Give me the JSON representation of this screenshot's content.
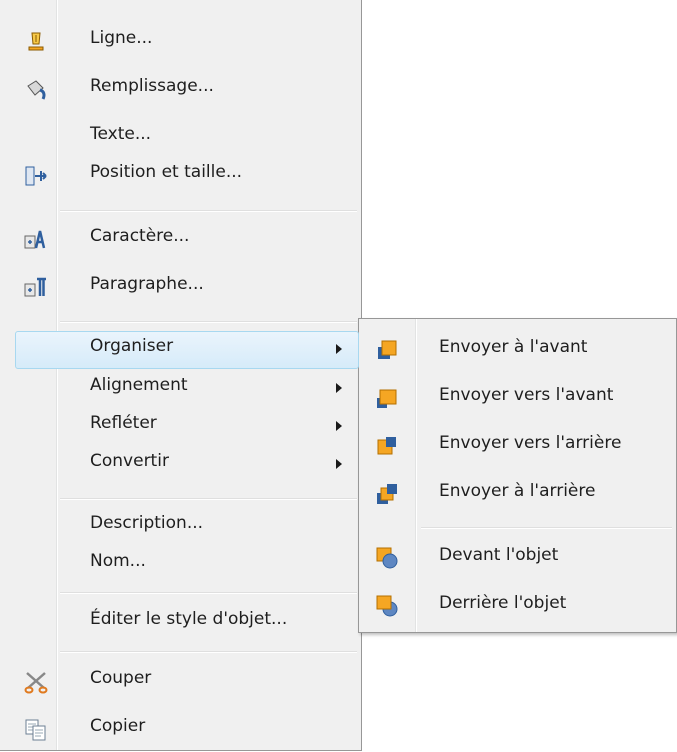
{
  "menu": {
    "items": [
      {
        "label": "Ligne...",
        "icon": "pencil-line-icon"
      },
      {
        "label": "Remplissage...",
        "icon": "paint-bucket-icon"
      },
      {
        "label": "Texte...",
        "icon": ""
      },
      {
        "label": "Position et taille...",
        "icon": "position-size-icon"
      },
      {
        "label": "Caractère...",
        "icon": "character-icon"
      },
      {
        "label": "Paragraphe...",
        "icon": "paragraph-icon"
      },
      {
        "label": "Organiser",
        "submenu": true,
        "highlighted": true
      },
      {
        "label": "Alignement",
        "submenu": true
      },
      {
        "label": "Refléter",
        "submenu": true
      },
      {
        "label": "Convertir",
        "submenu": true
      },
      {
        "label": "Description..."
      },
      {
        "label": "Nom..."
      },
      {
        "label": "Éditer le style d'objet..."
      },
      {
        "label": "Couper",
        "icon": "scissors-icon"
      },
      {
        "label": "Copier",
        "icon": "copy-icon"
      }
    ]
  },
  "submenu": {
    "items": [
      {
        "label": "Envoyer à l'avant",
        "icon": "bring-to-front-icon"
      },
      {
        "label": "Envoyer vers l'avant",
        "icon": "bring-forward-icon"
      },
      {
        "label": "Envoyer vers l'arrière",
        "icon": "send-backward-icon"
      },
      {
        "label": "Envoyer à l'arrière",
        "icon": "send-to-back-icon"
      },
      {
        "label": "Devant l'objet",
        "icon": "in-front-of-object-icon"
      },
      {
        "label": "Derrière l'objet",
        "icon": "behind-object-icon"
      }
    ]
  },
  "colors": {
    "highlight_border": "#a8d8f0",
    "highlight_fill": "#d6ebf9",
    "icon_orange": "#f5a623",
    "icon_blue": "#2f5f9e"
  }
}
